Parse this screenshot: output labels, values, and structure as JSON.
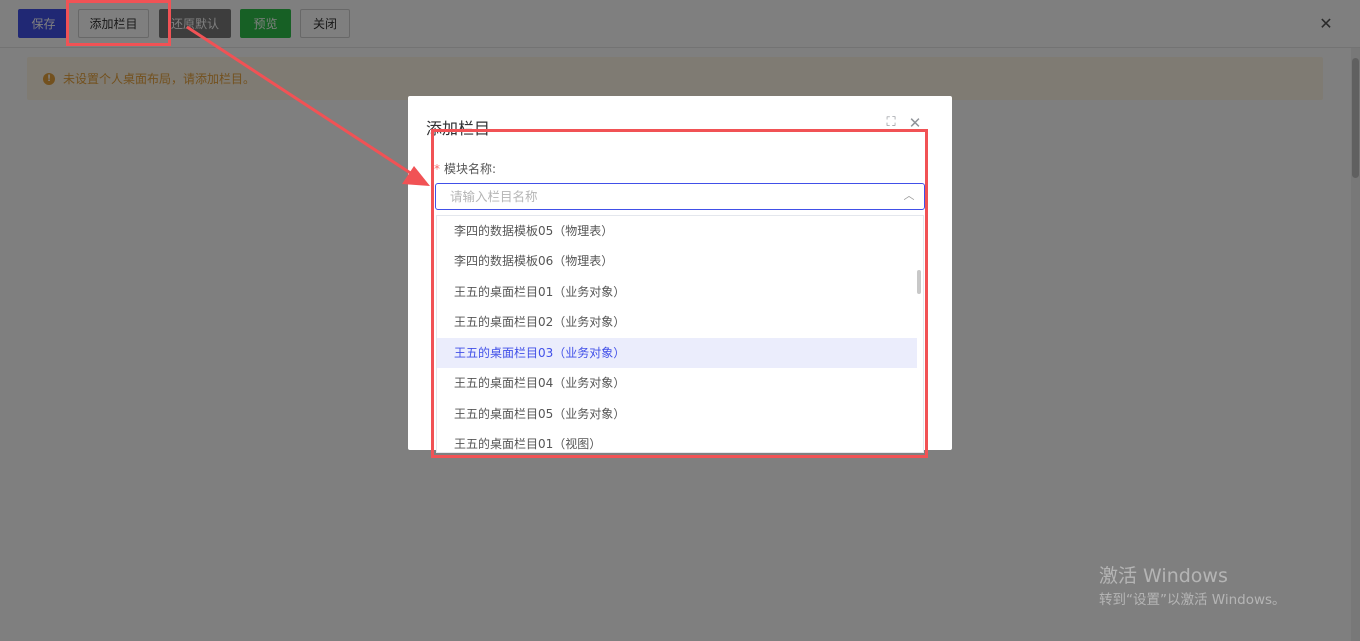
{
  "toolbar": {
    "save": "保存",
    "add_column": "添加栏目",
    "restore_default": "还原默认",
    "preview": "预览",
    "close": "关闭",
    "close_icon": "✕"
  },
  "warning": {
    "icon": "!",
    "text": "未设置个人桌面布局，请添加栏目。"
  },
  "dialog": {
    "title": "添加栏目",
    "maximize_icon": "⛶",
    "close_icon": "✕",
    "field_required_mark": "*",
    "field_label": "模块名称:",
    "input_placeholder": "请输入栏目名称",
    "input_value": "",
    "arrow_icon": "︿"
  },
  "dropdown": {
    "items": [
      {
        "label": "李四的数据模板05（物理表）",
        "active": false
      },
      {
        "label": "李四的数据模板06（物理表）",
        "active": false
      },
      {
        "label": "王五的桌面栏目01（业务对象）",
        "active": false
      },
      {
        "label": "王五的桌面栏目02（业务对象）",
        "active": false
      },
      {
        "label": "王五的桌面栏目03（业务对象）",
        "active": true
      },
      {
        "label": "王五的桌面栏目04（业务对象）",
        "active": false
      },
      {
        "label": "王五的桌面栏目05（业务对象）",
        "active": false
      },
      {
        "label": "王五的桌面栏目01（视图）",
        "active": false
      }
    ]
  },
  "watermark": {
    "title": "激活 Windows",
    "subtitle": "转到“设置”以激活 Windows。"
  },
  "colors": {
    "primary": "#4150e8",
    "success": "#2ec04a",
    "warning": "#e6a23c",
    "annotation": "#f15255"
  }
}
